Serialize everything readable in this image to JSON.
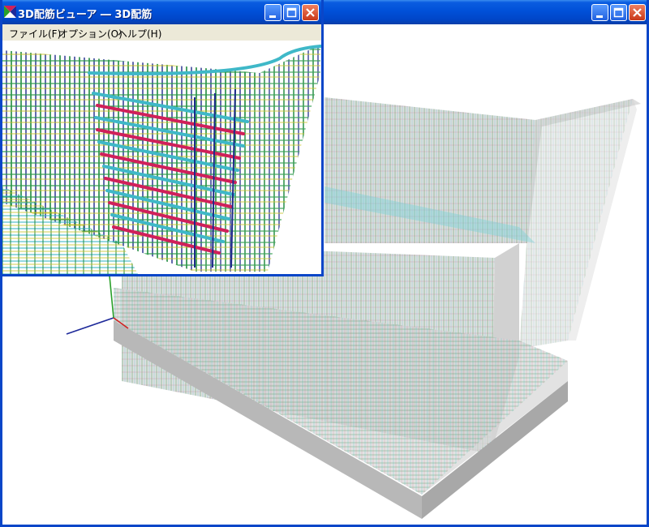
{
  "main_window": {
    "title": "",
    "controls": [
      "minimize",
      "maximize",
      "close"
    ]
  },
  "inset_window": {
    "title": "3D配筋ビューア ― 3D配筋",
    "menu": [
      {
        "label": "ファイル(F)"
      },
      {
        "label": "オプション(O)"
      },
      {
        "label": "ヘルプ(H)"
      }
    ],
    "controls": [
      "minimize",
      "maximize",
      "close"
    ]
  },
  "icons": [
    "app-icon",
    "minimize-icon",
    "maximize-icon",
    "close-icon",
    "axis-gizmo-icon"
  ],
  "colors": {
    "titlebar": "#0050d8",
    "menubar": "#ece9d8",
    "rebar_green": "#1e8a3c",
    "rebar_cyan": "#3fb8c8",
    "rebar_magenta": "#d0205a",
    "rebar_navy": "#1e2a8a",
    "rebar_yellow": "#c8c020",
    "concrete": "#c8c8c8"
  }
}
